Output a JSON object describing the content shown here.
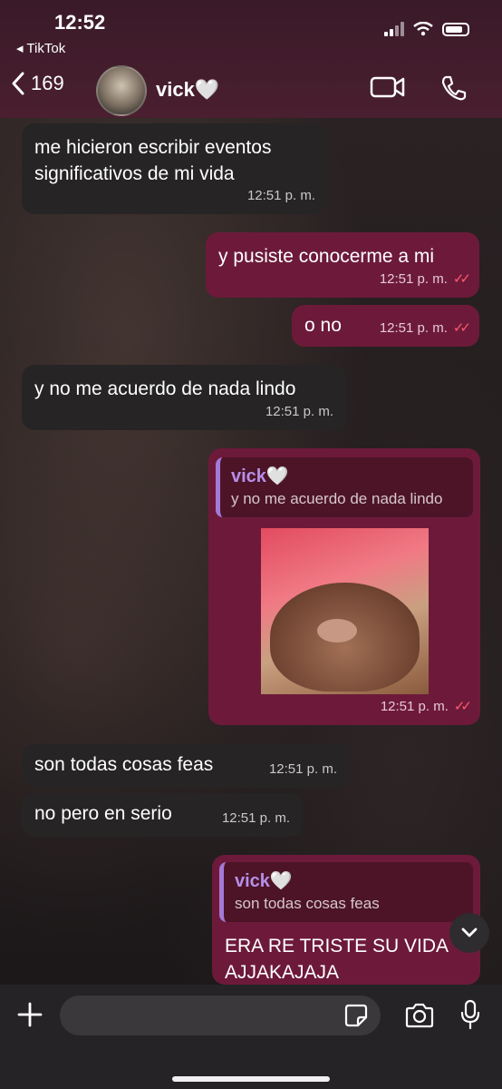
{
  "status_bar": {
    "time": "12:52",
    "back_app": "◂ TikTok"
  },
  "header": {
    "back_count": "169",
    "contact_name": "vick🤍"
  },
  "messages": [
    {
      "text_line1": "me hicieron escribir eventos",
      "text_line2": "significativos de mi vida",
      "time": "12:51 p. m."
    },
    {
      "text": "y pusiste conocerme a mi",
      "time": "12:51 p. m."
    },
    {
      "text": "o no",
      "time": "12:51 p. m."
    },
    {
      "text": "y no me acuerdo de nada lindo",
      "time": "12:51 p. m."
    },
    {
      "quote_name": "vick🤍",
      "quote_text": "y no me acuerdo de nada lindo",
      "time": "12:51 p. m."
    },
    {
      "text": "son todas cosas feas",
      "time": "12:51 p. m."
    },
    {
      "text": "no pero en serio",
      "time": "12:51 p. m."
    },
    {
      "quote_name": "vick🤍",
      "quote_text": "son todas cosas feas",
      "text_line1": "ERA RE TRISTE SU VIDA",
      "text_line2": "AJJAKAJAJA"
    }
  ],
  "icons": [
    "chevron-left-icon",
    "video-call-icon",
    "phone-icon",
    "plus-icon",
    "sticker-icon",
    "camera-icon",
    "microphone-icon",
    "chevron-down-icon",
    "double-check-icon"
  ]
}
